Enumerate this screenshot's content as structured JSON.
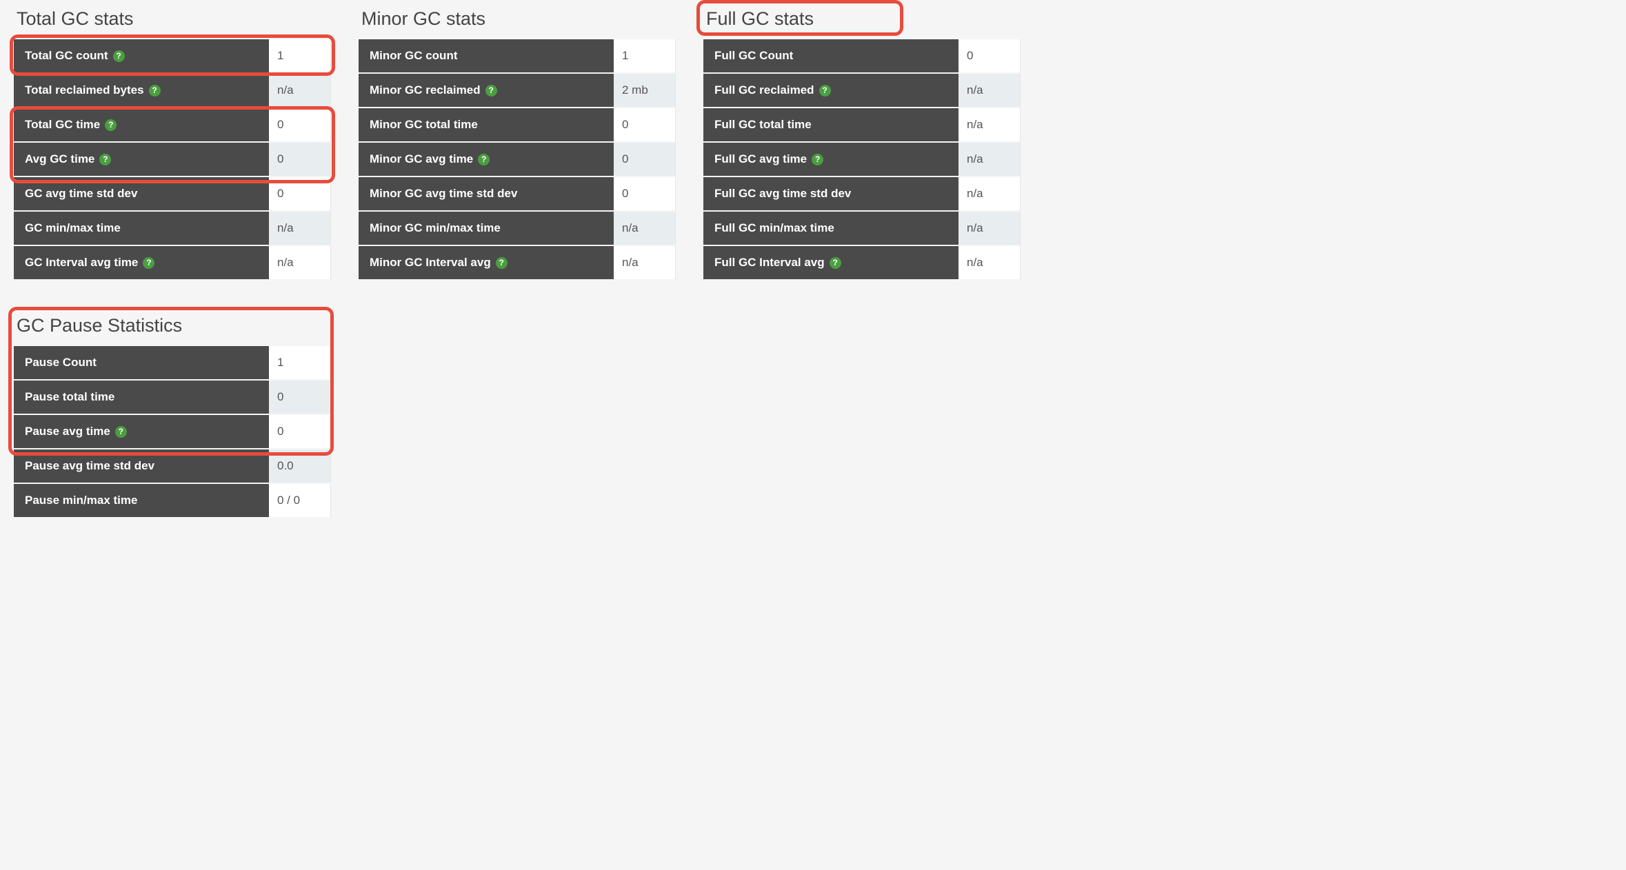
{
  "icons": {
    "help": "?"
  },
  "panels": {
    "total": {
      "title": "Total GC stats",
      "rows": [
        {
          "label": "Total GC count",
          "help": true,
          "value": "1"
        },
        {
          "label": "Total reclaimed bytes",
          "help": true,
          "value": "n/a"
        },
        {
          "label": "Total GC time",
          "help": true,
          "value": "0"
        },
        {
          "label": "Avg GC time",
          "help": true,
          "value": "0"
        },
        {
          "label": "GC avg time std dev",
          "help": false,
          "value": "0"
        },
        {
          "label": "GC min/max time",
          "help": false,
          "value": "n/a"
        },
        {
          "label": "GC Interval avg time",
          "help": true,
          "value": "n/a"
        }
      ]
    },
    "minor": {
      "title": "Minor GC stats",
      "rows": [
        {
          "label": "Minor GC count",
          "help": false,
          "value": "1"
        },
        {
          "label": "Minor GC reclaimed",
          "help": true,
          "value": "2 mb"
        },
        {
          "label": "Minor GC total time",
          "help": false,
          "value": "0"
        },
        {
          "label": "Minor GC avg time",
          "help": true,
          "value": "0"
        },
        {
          "label": "Minor GC avg time std dev",
          "help": false,
          "value": "0"
        },
        {
          "label": "Minor GC min/max time",
          "help": false,
          "value": "n/a"
        },
        {
          "label": "Minor GC Interval avg",
          "help": true,
          "value": "n/a"
        }
      ]
    },
    "full": {
      "title": "Full GC stats",
      "rows": [
        {
          "label": "Full GC Count",
          "help": false,
          "value": "0"
        },
        {
          "label": "Full GC reclaimed",
          "help": true,
          "value": "n/a"
        },
        {
          "label": "Full GC total time",
          "help": false,
          "value": "n/a"
        },
        {
          "label": "Full GC avg time",
          "help": true,
          "value": "n/a"
        },
        {
          "label": "Full GC avg time std dev",
          "help": false,
          "value": "n/a"
        },
        {
          "label": "Full GC min/max time",
          "help": false,
          "value": "n/a"
        },
        {
          "label": "Full GC Interval avg",
          "help": true,
          "value": "n/a"
        }
      ]
    },
    "pause": {
      "title": "GC Pause Statistics",
      "rows": [
        {
          "label": "Pause Count",
          "help": false,
          "value": "1"
        },
        {
          "label": "Pause total time",
          "help": false,
          "value": "0"
        },
        {
          "label": "Pause avg time",
          "help": true,
          "value": "0"
        },
        {
          "label": "Pause avg time std dev",
          "help": false,
          "value": "0.0"
        },
        {
          "label": "Pause min/max time",
          "help": false,
          "value": "0 / 0"
        }
      ]
    }
  }
}
